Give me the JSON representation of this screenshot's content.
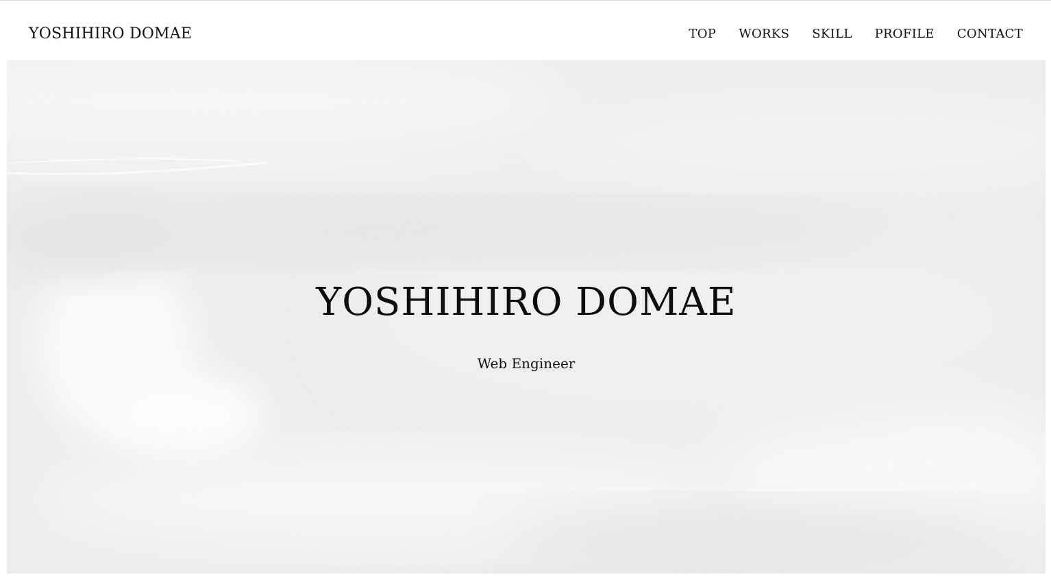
{
  "header": {
    "logo": "YOSHIHIRO DOMAE",
    "nav": [
      {
        "label": "TOP"
      },
      {
        "label": "WORKS"
      },
      {
        "label": "SKILL"
      },
      {
        "label": "PROFILE"
      },
      {
        "label": "CONTACT"
      }
    ]
  },
  "hero": {
    "title": "YOSHIHIRO DOMAE",
    "subtitle": "Web Engineer",
    "background_color": "#eeeeee"
  }
}
